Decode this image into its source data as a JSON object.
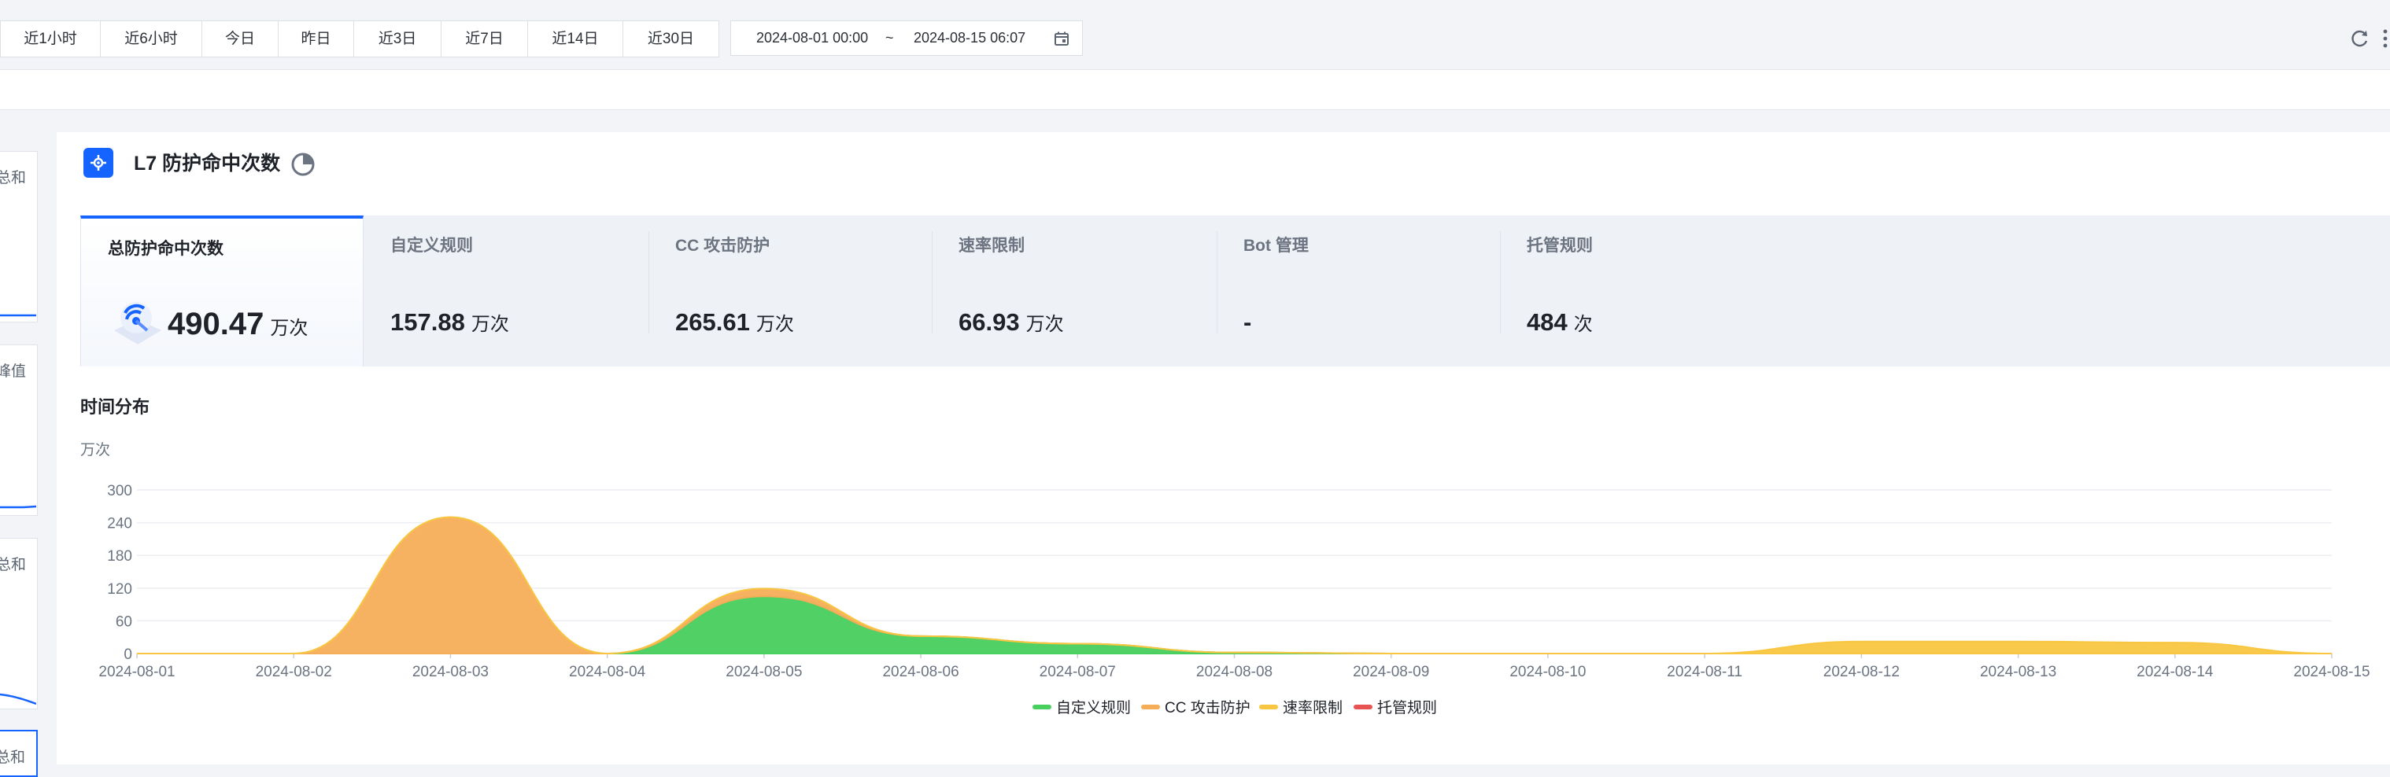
{
  "toolbar": {
    "ranges": [
      "近1小时",
      "近6小时",
      "今日",
      "昨日",
      "近3日",
      "近7日",
      "近14日",
      "近30日"
    ],
    "date_start": "2024-08-01 00:00",
    "date_sep": "~",
    "date_end": "2024-08-15 06:07",
    "calendar_icon": "calendar-icon",
    "refresh_icon": "refresh-icon",
    "more_icon": "more-vertical-icon"
  },
  "side_cards": [
    {
      "label": "总和"
    },
    {
      "label": "峰值"
    },
    {
      "label": "总和"
    },
    {
      "label": "总和"
    }
  ],
  "panel": {
    "title": "L7 防护命中次数",
    "pie_icon": "pie-chart-icon",
    "stats": [
      {
        "label": "总防护命中次数",
        "value": "490.47",
        "unit": "万次"
      },
      {
        "label": "自定义规则",
        "value": "157.88",
        "unit": "万次"
      },
      {
        "label": "CC 攻击防护",
        "value": "265.61",
        "unit": "万次"
      },
      {
        "label": "速率限制",
        "value": "66.93",
        "unit": "万次"
      },
      {
        "label": "Bot 管理",
        "value": "-",
        "unit": ""
      },
      {
        "label": "托管规则",
        "value": "484",
        "unit": "次"
      }
    ],
    "section_title": "时间分布",
    "unit_label": "万次"
  },
  "colors": {
    "accent": "#1664ff",
    "custom_rule": "#48cf5d",
    "cc_attack": "#f5ad58",
    "rate_limit": "#f8c640",
    "managed_rule": "#e85454"
  },
  "chart_data": {
    "type": "area",
    "stacked": true,
    "x": [
      "2024-08-01",
      "2024-08-02",
      "2024-08-03",
      "2024-08-04",
      "2024-08-05",
      "2024-08-06",
      "2024-08-07",
      "2024-08-08",
      "2024-08-09",
      "2024-08-10",
      "2024-08-11",
      "2024-08-12",
      "2024-08-13",
      "2024-08-14",
      "2024-08-15"
    ],
    "ylabel": "万次",
    "ylim": [
      0,
      300
    ],
    "yticks": [
      0,
      60,
      120,
      180,
      240,
      300
    ],
    "grid": true,
    "legend_position": "bottom",
    "series": [
      {
        "name": "自定义规则",
        "color": "#48cf5d",
        "values": [
          0,
          0,
          0,
          0,
          105,
          32,
          18,
          2,
          0,
          0,
          0,
          0,
          0,
          0,
          0
        ]
      },
      {
        "name": "CC 攻击防护",
        "color": "#f5ad58",
        "values": [
          0,
          0,
          250,
          0,
          14,
          0,
          0,
          0,
          0,
          0,
          0,
          0,
          0,
          0,
          0
        ]
      },
      {
        "name": "速率限制",
        "color": "#f8c640",
        "values": [
          0,
          0,
          0,
          0,
          0,
          0,
          0,
          0,
          0,
          0,
          0,
          22,
          22,
          20,
          0
        ]
      },
      {
        "name": "托管规则",
        "color": "#e85454",
        "values": [
          0,
          0,
          0,
          0,
          0,
          0,
          0,
          0,
          0,
          0,
          0,
          0,
          0,
          0,
          0
        ]
      }
    ]
  }
}
